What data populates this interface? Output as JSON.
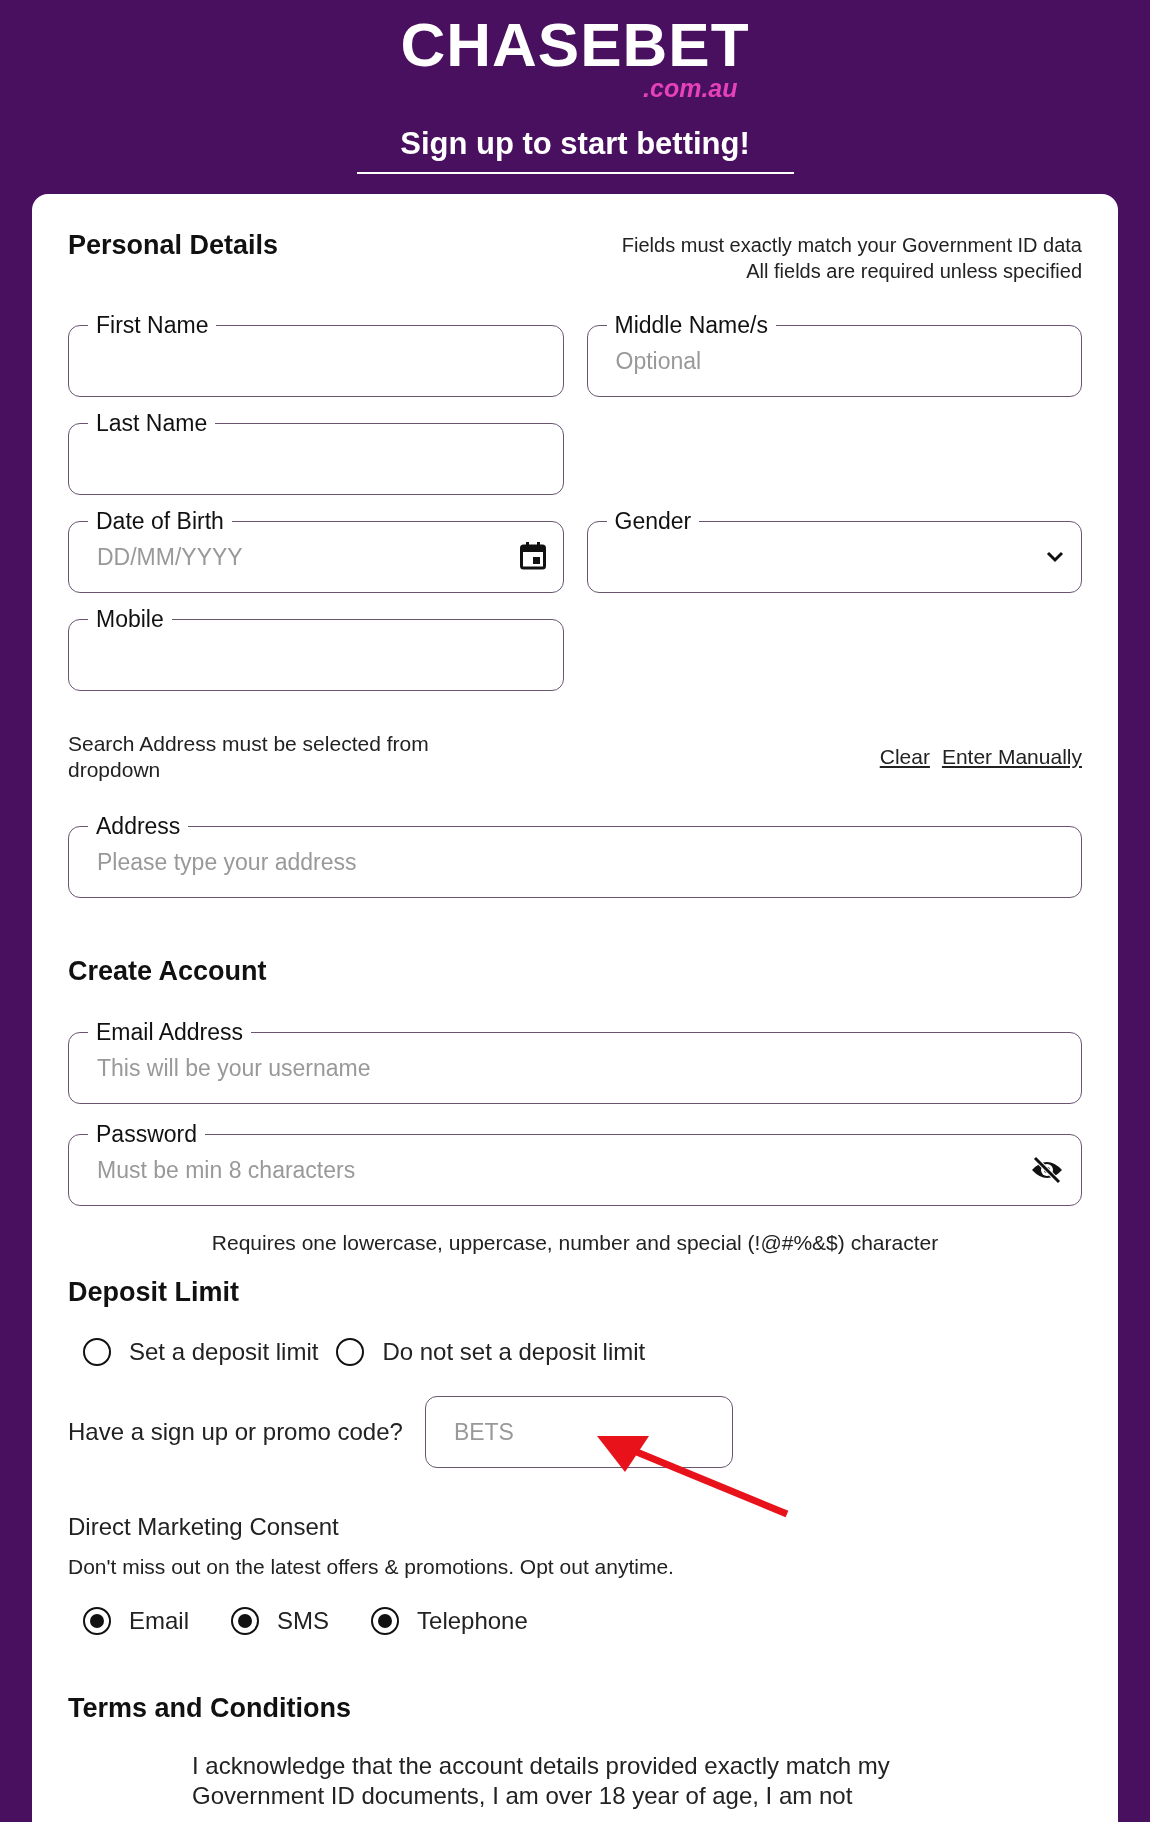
{
  "header": {
    "logo": "CHASEBET",
    "logo_domain": ".com.au",
    "title": "Sign up to start betting!"
  },
  "personal": {
    "heading": "Personal Details",
    "notes": [
      "Fields must exactly match your Government ID data",
      "All fields are required unless specified"
    ],
    "rows": [
      {
        "fields": [
          {
            "kind": "text",
            "label": "First Name"
          },
          {
            "kind": "text",
            "label": "Middle Name/s",
            "placeholder": "Optional"
          }
        ]
      },
      {
        "fields": [
          {
            "kind": "text",
            "label": "Last Name"
          }
        ]
      },
      {
        "fields": [
          {
            "kind": "date",
            "label": "Date of Birth",
            "placeholder": "DD/MM/YYYY"
          },
          {
            "kind": "select",
            "label": "Gender"
          }
        ]
      },
      {
        "fields": [
          {
            "kind": "text",
            "label": "Mobile"
          }
        ]
      }
    ],
    "address_note": "Search Address must be selected from dropdown",
    "address_links": [
      "Clear",
      "Enter Manually"
    ],
    "address": {
      "kind": "text",
      "label": "Address",
      "placeholder": "Please type your address"
    }
  },
  "account": {
    "heading": "Create Account",
    "fields": [
      {
        "kind": "text",
        "label": "Email Address",
        "placeholder": "This will be your username"
      },
      {
        "kind": "password",
        "label": "Password",
        "placeholder": "Must be min 8 characters"
      }
    ],
    "hint": "Requires one lowercase, uppercase, number and special (!@#%&$) character"
  },
  "deposit": {
    "heading": "Deposit Limit",
    "options": [
      {
        "label": "Set a deposit limit",
        "selected": false
      },
      {
        "label": "Do not set a deposit limit",
        "selected": false
      }
    ],
    "promo_label": "Have a sign up or promo code?",
    "promo_placeholder": "BETS"
  },
  "marketing": {
    "heading": "Direct Marketing Consent",
    "subtitle": "Don't miss out on the latest offers & promotions. Opt out anytime.",
    "options": [
      {
        "label": "Email",
        "checked": true
      },
      {
        "label": "SMS",
        "checked": true
      },
      {
        "label": "Telephone",
        "checked": true
      }
    ]
  },
  "terms": {
    "heading": "Terms and Conditions",
    "lines": [
      "I acknowledge that the account details provided exactly match my",
      "Government ID documents, I am over 18 year of age, I am not"
    ]
  }
}
